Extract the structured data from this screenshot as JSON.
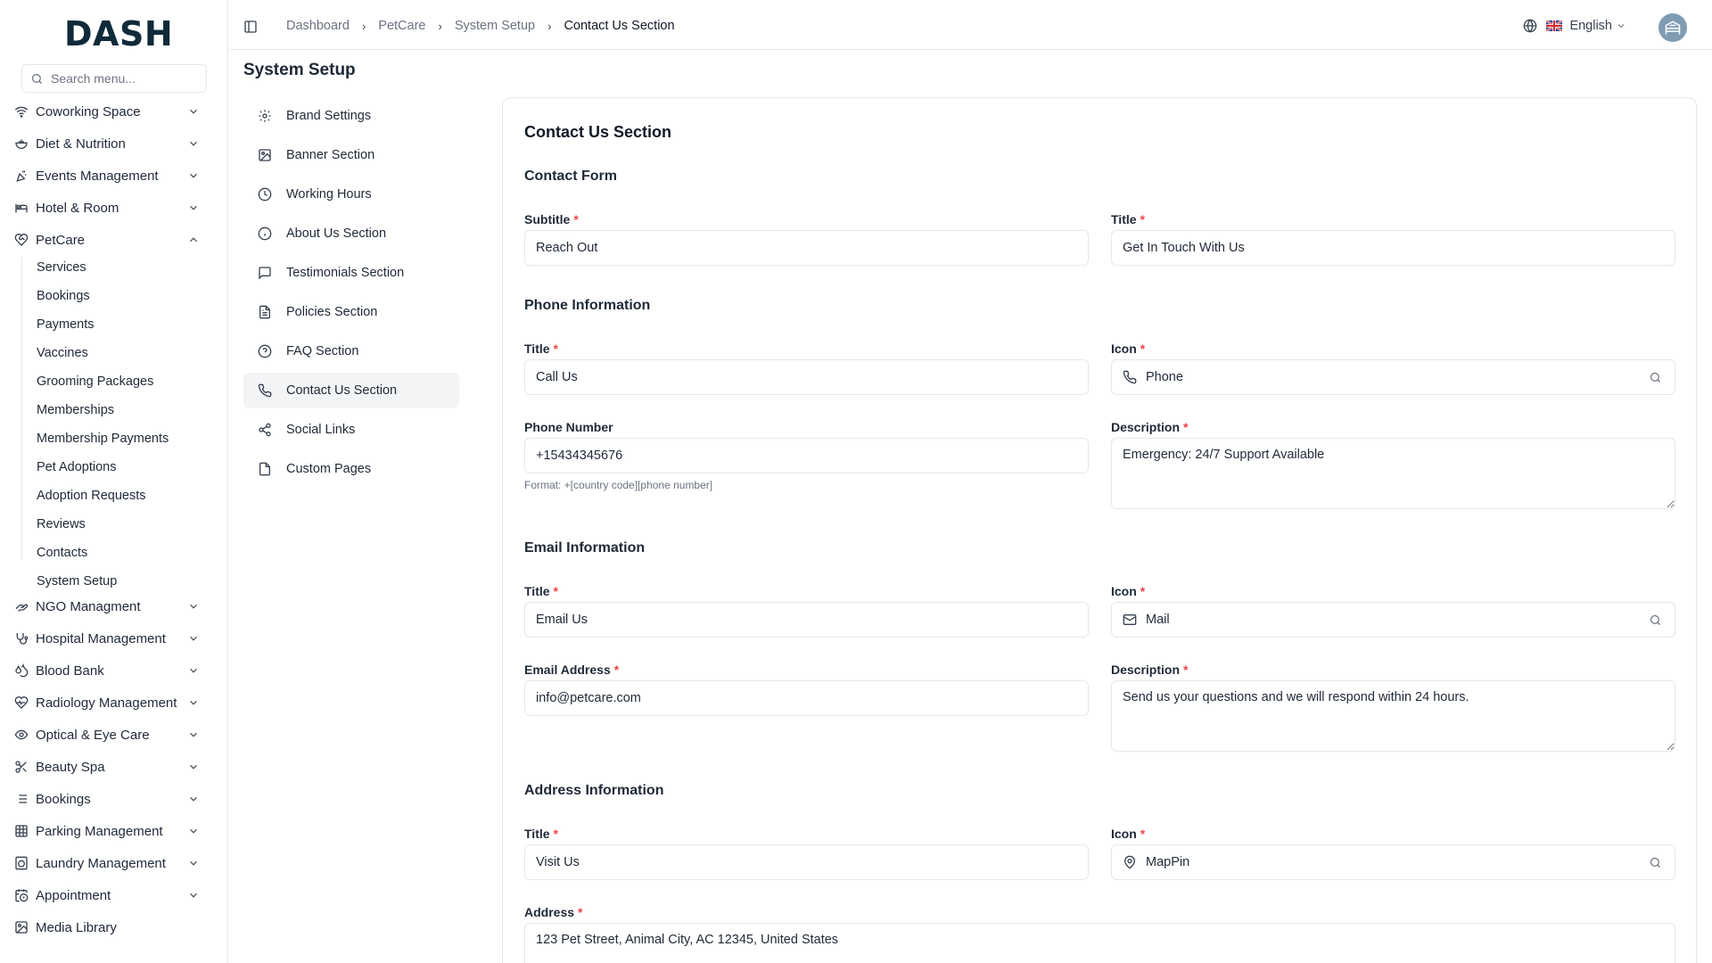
{
  "app": {
    "logo": "DASH"
  },
  "search": {
    "placeholder": "Search menu..."
  },
  "sidebar": {
    "items": [
      {
        "label": "Coworking Space"
      },
      {
        "label": "Diet & Nutrition"
      },
      {
        "label": "Events Management"
      },
      {
        "label": "Hotel & Room"
      },
      {
        "label": "PetCare"
      },
      {
        "label": "NGO Managment"
      },
      {
        "label": "Hospital Management"
      },
      {
        "label": "Blood Bank"
      },
      {
        "label": "Radiology Management"
      },
      {
        "label": "Optical & Eye Care"
      },
      {
        "label": "Beauty Spa"
      },
      {
        "label": "Bookings"
      },
      {
        "label": "Parking Management"
      },
      {
        "label": "Laundry Management"
      },
      {
        "label": "Appointment"
      },
      {
        "label": "Media Library"
      }
    ],
    "petcare_sub": [
      "Services",
      "Bookings",
      "Payments",
      "Vaccines",
      "Grooming Packages",
      "Memberships",
      "Membership Payments",
      "Pet Adoptions",
      "Adoption Requests",
      "Reviews",
      "Contacts",
      "System Setup"
    ]
  },
  "breadcrumb": [
    "Dashboard",
    "PetCare",
    "System Setup",
    "Contact Us Section"
  ],
  "header": {
    "language": "English"
  },
  "page": {
    "title": "System Setup"
  },
  "setup_nav": [
    "Brand Settings",
    "Banner Section",
    "Working Hours",
    "About Us Section",
    "Testimonials Section",
    "Policies Section",
    "FAQ Section",
    "Contact Us Section",
    "Social Links",
    "Custom Pages"
  ],
  "form": {
    "title": "Contact Us Section",
    "contact_form": {
      "heading": "Contact Form",
      "subtitle_label": "Subtitle",
      "subtitle_value": "Reach Out",
      "title_label": "Title",
      "title_value": "Get In Touch With Us"
    },
    "phone": {
      "heading": "Phone Information",
      "title_label": "Title",
      "title_value": "Call Us",
      "icon_label": "Icon",
      "icon_value": "Phone",
      "number_label": "Phone Number",
      "number_value": "+15434345676",
      "number_hint": "Format: +[country code][phone number]",
      "desc_label": "Description",
      "desc_value": "Emergency: 24/7 Support Available"
    },
    "email": {
      "heading": "Email Information",
      "title_label": "Title",
      "title_value": "Email Us",
      "icon_label": "Icon",
      "icon_value": "Mail",
      "address_label": "Email Address",
      "address_value": "info@petcare.com",
      "desc_label": "Description",
      "desc_value": "Send us your questions and we will respond within 24 hours."
    },
    "address": {
      "heading": "Address Information",
      "title_label": "Title",
      "title_value": "Visit Us",
      "icon_label": "Icon",
      "icon_value": "MapPin",
      "address_label": "Address",
      "address_value": "123 Pet Street, Animal City, AC 12345, United States"
    },
    "required_mark": "*"
  },
  "colors": {
    "accent": "#10b981",
    "required": "#ef4444",
    "active_bg": "#f3f4f6"
  }
}
